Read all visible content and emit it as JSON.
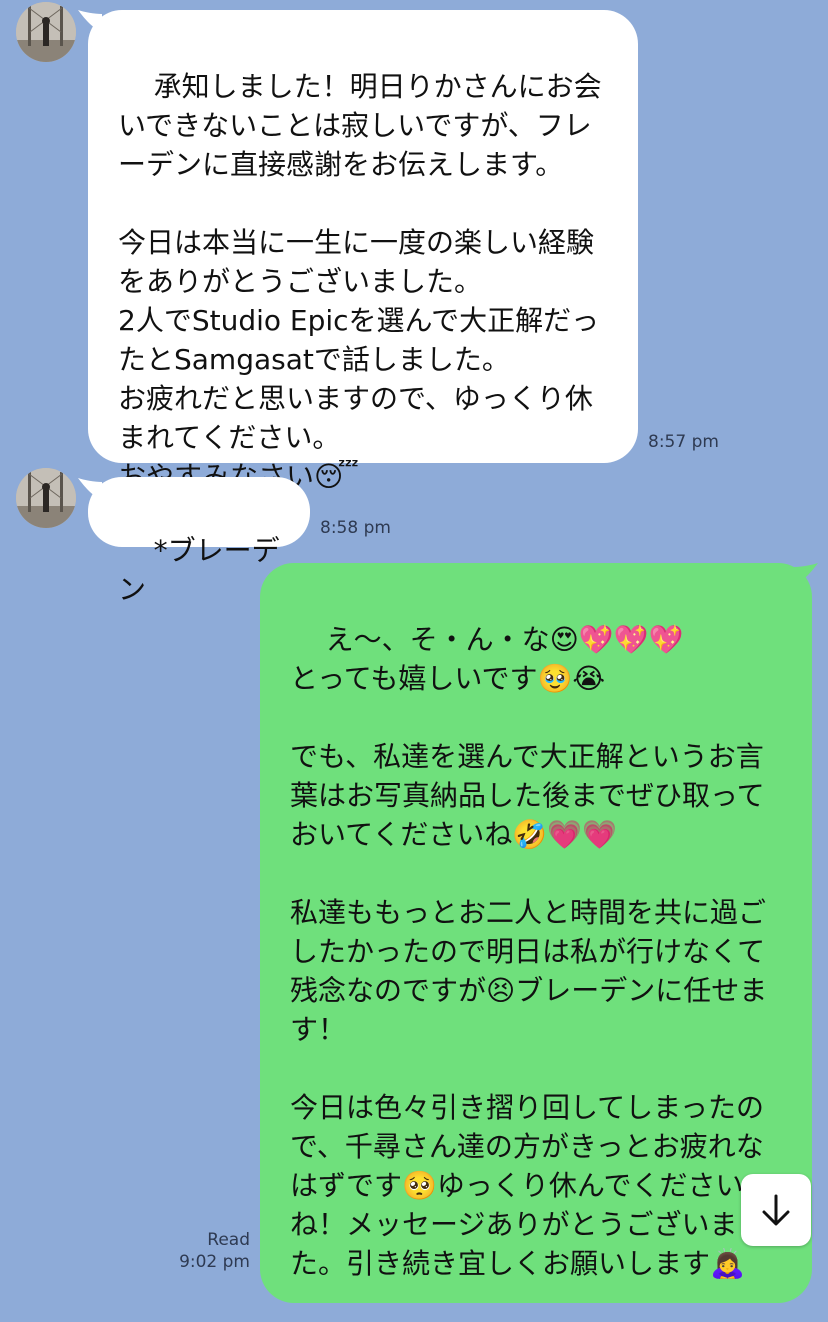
{
  "colors": {
    "background": "#8eabd8",
    "incoming_bubble": "#ffffff",
    "outgoing_bubble": "#6fe07c",
    "text": "#111111",
    "meta_text": "#2e3a52"
  },
  "messages": [
    {
      "direction": "incoming",
      "avatar": "bridge-photo-avatar",
      "text": "承知しました！明日りかさんにお会いできないことは寂しいですが、フレーデンに直接感謝をお伝えします。\n\n今日は本当に一生に一度の楽しい経験をありがとうございました。\n2人でStudio Epicを選んで大正解だったとSamgasatで話しました。\nお疲れだと思いますので、ゆっくり休まれてください。\nおやすみなさい😴",
      "time": "8:57 pm"
    },
    {
      "direction": "incoming",
      "avatar": "bridge-photo-avatar",
      "text": "*ブレーデン",
      "time": "8:58 pm"
    },
    {
      "direction": "outgoing",
      "text": "え〜、そ・ん・な😍💖💖💖\nとっても嬉しいです🥹😭\n\nでも、私達を選んで大正解というお言葉はお写真納品した後までぜひ取っておいてくださいね🤣💗💗\n\n私達ももっとお二人と時間を共に過ごしたかったので明日は私が行けなくて残念なのですが😣ブレーデンに任せます！\n\n今日は色々引き摺り回してしまったので、千尋さん達の方がきっとお疲れなはずです🥺ゆっくり休んでくださいね！メッセージありがとうございました。引き続き宜しくお願いします🙇‍♀️",
      "status": "Read",
      "time": "9:02 pm"
    }
  ],
  "scroll_button": {
    "icon": "arrow-down-icon"
  }
}
